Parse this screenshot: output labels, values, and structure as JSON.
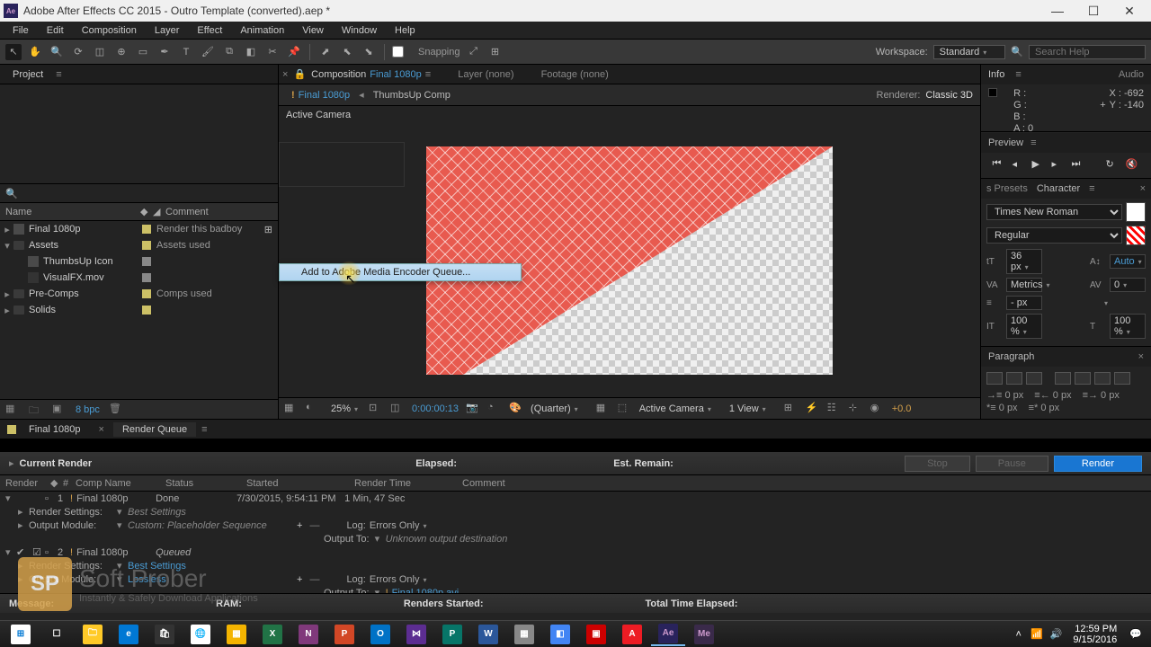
{
  "title": "Adobe After Effects CC 2015 - Outro Template (converted).aep *",
  "menubar": [
    "File",
    "Edit",
    "Composition",
    "Layer",
    "Effect",
    "Animation",
    "View",
    "Window",
    "Help"
  ],
  "toolbar": {
    "snapping": "Snapping",
    "workspace_label": "Workspace:",
    "workspace_value": "Standard",
    "search_placeholder": "Search Help"
  },
  "project": {
    "tab": "Project",
    "columns": {
      "name": "Name",
      "comment": "Comment"
    },
    "items": [
      {
        "expand": "▸",
        "type": "comp",
        "name": "Final 1080p",
        "comment": "Render this badboy",
        "indent": 0
      },
      {
        "expand": "▾",
        "type": "folder",
        "name": "Assets",
        "comment": "Assets used",
        "indent": 0
      },
      {
        "expand": "",
        "type": "comp",
        "name": "ThumbsUp Icon",
        "comment": "",
        "indent": 1,
        "grey": true
      },
      {
        "expand": "",
        "type": "mov",
        "name": "VisualFX.mov",
        "comment": "",
        "indent": 1,
        "grey": true
      },
      {
        "expand": "▸",
        "type": "folder",
        "name": "Pre-Comps",
        "comment": "Comps used",
        "indent": 0
      },
      {
        "expand": "▸",
        "type": "folder",
        "name": "Solids",
        "comment": "",
        "indent": 0
      }
    ],
    "bpc": "8 bpc"
  },
  "comp": {
    "tab_label": "Composition",
    "tab_name": "Final 1080p",
    "layer_tab": "Layer (none)",
    "footage_tab": "Footage (none)",
    "crumb1": "Final 1080p",
    "crumb2": "ThumbsUp Comp",
    "renderer_label": "Renderer:",
    "renderer_value": "Classic 3D",
    "camera": "Active Camera",
    "context_menu_item": "Add to Adobe Media Encoder Queue...",
    "footer": {
      "zoom": "25%",
      "time": "0:00:00:13",
      "quality": "(Quarter)",
      "view": "Active Camera",
      "views": "1 View",
      "exposure": "+0.0"
    }
  },
  "info": {
    "tab1": "Info",
    "tab2": "Audio",
    "r": "R :",
    "g": "G :",
    "b": "B :",
    "a": "A : 0",
    "x": "X : -692",
    "y": "Y : -140"
  },
  "preview": {
    "tab": "Preview"
  },
  "presets": {
    "tab": "s Presets",
    "char_tab": "Character"
  },
  "character": {
    "font": "Times New Roman",
    "style": "Regular",
    "size": "36 px",
    "leading": "Auto",
    "kerning": "Metrics",
    "tracking": "0",
    "stroke": "- px",
    "vscale": "100 %",
    "hscale": "100 %",
    "baseline": "- px",
    "tsume": "- %"
  },
  "paragraph": {
    "tab": "Paragraph",
    "indent": "0 px"
  },
  "timeline": {
    "tabs": [
      "Final 1080p",
      "Render Queue"
    ],
    "current_render": "Current Render",
    "elapsed": "Elapsed:",
    "est_remain": "Est. Remain:",
    "stop": "Stop",
    "pause": "Pause",
    "render": "Render",
    "headers": {
      "render": "Render",
      "comp": "Comp Name",
      "status": "Status",
      "started": "Started",
      "rtime": "Render Time",
      "comment": "Comment"
    },
    "items": [
      {
        "num": "1",
        "comp": "Final 1080p",
        "status": "Done",
        "started": "7/30/2015, 9:54:11 PM",
        "rtime": "1 Min, 47 Sec"
      },
      {
        "settings_label": "Render Settings:",
        "settings_val": "Best Settings",
        "type": "settings"
      },
      {
        "out_label": "Output Module:",
        "out_val": "Custom: Placeholder Sequence",
        "log_label": "Log:",
        "log_val": "Errors Only",
        "output_to": "Output To:",
        "out_file": "Unknown output destination",
        "ital": true,
        "type": "output"
      },
      {
        "num": "2",
        "comp": "Final 1080p",
        "status": "Queued",
        "checked": true
      },
      {
        "settings_label": "Render Settings:",
        "settings_val": "Best Settings",
        "link": true,
        "type": "settings"
      },
      {
        "out_label": "Output Module:",
        "out_val": "Lossless",
        "link": true,
        "log_label": "Log:",
        "log_val": "Errors Only",
        "output_to": "Output To:",
        "out_file": "Final 1080p.avi",
        "file_link": true,
        "type": "output"
      }
    ],
    "footer": {
      "message": "Message:",
      "ram": "RAM:",
      "renders_started": "Renders Started:",
      "total": "Total Time Elapsed:"
    }
  },
  "watermark": {
    "brand": "Soft Prober",
    "tag": "Instantly & Safely Download Applications",
    "logo": "SP"
  },
  "taskbar": {
    "time": "12:59 PM",
    "date": "9/15/2016"
  }
}
